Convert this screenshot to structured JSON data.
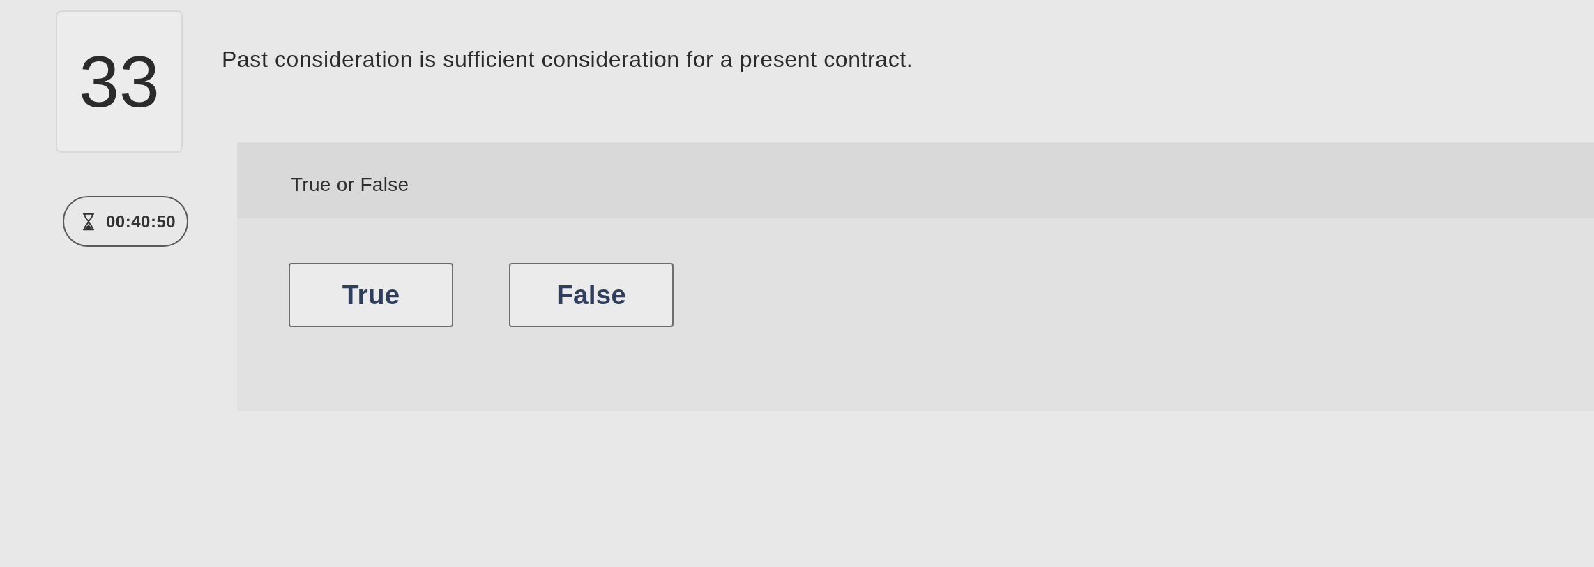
{
  "question": {
    "number": "33",
    "text": "Past consideration is sufficient consideration for a present contract."
  },
  "timer": {
    "time": "00:40:50"
  },
  "answer_panel": {
    "prompt": "True or False",
    "options": [
      {
        "label": "True",
        "selected": false
      },
      {
        "label": "False",
        "selected": false
      }
    ]
  }
}
